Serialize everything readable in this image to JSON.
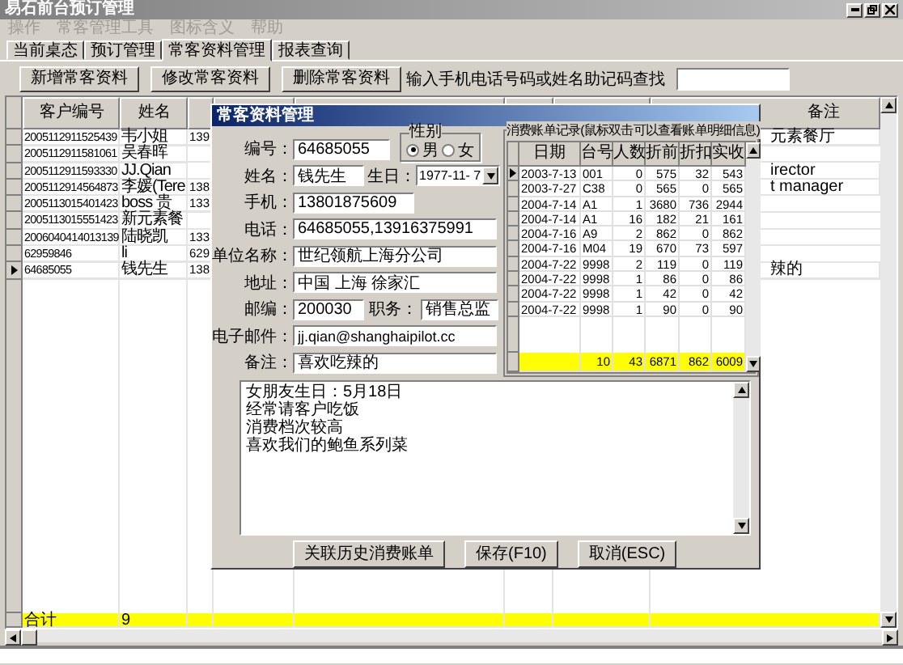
{
  "window": {
    "title": "易石前台预订管理"
  },
  "menu": [
    {
      "label": "操作",
      "disabled": true
    },
    {
      "label": "常客管理工具",
      "disabled": true
    },
    {
      "label": "图标含义",
      "disabled": true
    },
    {
      "label": "帮助",
      "disabled": true
    }
  ],
  "tabs": [
    {
      "label": "当前桌态",
      "selected": false
    },
    {
      "label": "预订管理",
      "selected": false
    },
    {
      "label": "常客资料管理",
      "selected": true
    },
    {
      "label": "报表查询",
      "selected": false
    }
  ],
  "toolbar": {
    "buttons": [
      "新增常客资料",
      "修改常客资料",
      "删除常客资料"
    ],
    "search_label": "输入手机电话号码或姓名助记码查找"
  },
  "grid": {
    "header_1": "客户编号",
    "header_2": "姓名",
    "header_remark": "备注",
    "rows": [
      {
        "id": "2005112911525439",
        "name": "韦小姐",
        "column_3": "139",
        "remark": "元素餐厅",
        "current": false
      },
      {
        "id": "2005112911581061",
        "name": "吴春晖",
        "column_3": "",
        "remark": "",
        "current": false
      },
      {
        "id": "2005112911593330",
        "name": "JJ.Qian",
        "column_3": "",
        "remark": "irector",
        "current": false
      },
      {
        "id": "2005112914564873",
        "name": "李媛(Tere",
        "column_3": "138",
        "remark": "t manager",
        "current": false
      },
      {
        "id": "2005113015401423",
        "name": "boss 贵",
        "column_3": "133",
        "remark": "",
        "current": false
      },
      {
        "id": "2005113015551423",
        "name": "新元素餐",
        "column_3": "",
        "remark": "",
        "current": false
      },
      {
        "id": "2006040414013139",
        "name": "陆晓凯",
        "column_3": "133",
        "remark": "",
        "current": false
      },
      {
        "id": "62959846",
        "name": "li",
        "column_3": "629",
        "remark": "",
        "current": false
      },
      {
        "id": "64685055",
        "name": "钱先生",
        "column_3": "138",
        "remark": "辣的",
        "current": true
      }
    ],
    "total": {
      "label": "合计",
      "count": "9"
    }
  },
  "dialog": {
    "title": "常客资料管理",
    "fields": {
      "number_label": "编号：",
      "number": "64685055",
      "name_label": "姓名：",
      "name": "钱先生",
      "mobile_label": "手机：",
      "mobile": "13801875609",
      "phone_label": "电话：",
      "phone": "64685055,13916375991",
      "company_label": "单位名称：",
      "company": "世纪领航上海分公司",
      "address_label": "地址：",
      "address": "中国 上海 徐家汇",
      "zip_label": "邮编：",
      "zip": "200030",
      "title_label": "职务：",
      "job_title": "销售总监",
      "email_label": "电子邮件：",
      "email": "jj.qian@shanghaipilot.cc",
      "note_label": "备注：",
      "note": "喜欢吃辣的"
    },
    "gender": {
      "label": "性别",
      "options": [
        {
          "label": "男",
          "selected": true
        },
        {
          "label": "女",
          "selected": false
        }
      ]
    },
    "birthday": {
      "label": "生日：",
      "value": "1977-11- 7"
    },
    "bills": {
      "title": "消费账单记录(鼠标双击可以查看账单明细信息)",
      "columns": [
        "日期",
        "台号",
        "人数",
        "折前",
        "折扣",
        "实收"
      ],
      "rows": [
        {
          "cells": [
            "2003-7-13",
            "001",
            "0",
            "575",
            "32",
            "543"
          ],
          "current": true
        },
        {
          "cells": [
            "2003-7-27",
            "C38",
            "0",
            "565",
            "0",
            "565"
          ],
          "current": false
        },
        {
          "cells": [
            "2004-7-14",
            "A1",
            "1",
            "3680",
            "736",
            "2944"
          ],
          "current": false
        },
        {
          "cells": [
            "2004-7-14",
            "A1",
            "16",
            "182",
            "21",
            "161"
          ],
          "current": false
        },
        {
          "cells": [
            "2004-7-16",
            "A9",
            "2",
            "862",
            "0",
            "862"
          ],
          "current": false
        },
        {
          "cells": [
            "2004-7-16",
            "M04",
            "19",
            "670",
            "73",
            "597"
          ],
          "current": false
        },
        {
          "cells": [
            "2004-7-22",
            "9998",
            "2",
            "119",
            "0",
            "119"
          ],
          "current": false
        },
        {
          "cells": [
            "2004-7-22",
            "9998",
            "1",
            "86",
            "0",
            "86"
          ],
          "current": false
        },
        {
          "cells": [
            "2004-7-22",
            "9998",
            "1",
            "42",
            "0",
            "42"
          ],
          "current": false
        },
        {
          "cells": [
            "2004-7-22",
            "9998",
            "1",
            "90",
            "0",
            "90"
          ],
          "current": false
        }
      ],
      "total": [
        "10",
        "43",
        "6871",
        "862",
        "6009"
      ]
    },
    "memo": [
      "女朋友生日：5月18日",
      "经常请客户吃饭",
      "消费档次较高",
      "喜欢我们的鲍鱼系列菜"
    ],
    "buttons": [
      "关联历史消费账单",
      "保存(F10)",
      "取消(ESC)"
    ]
  }
}
